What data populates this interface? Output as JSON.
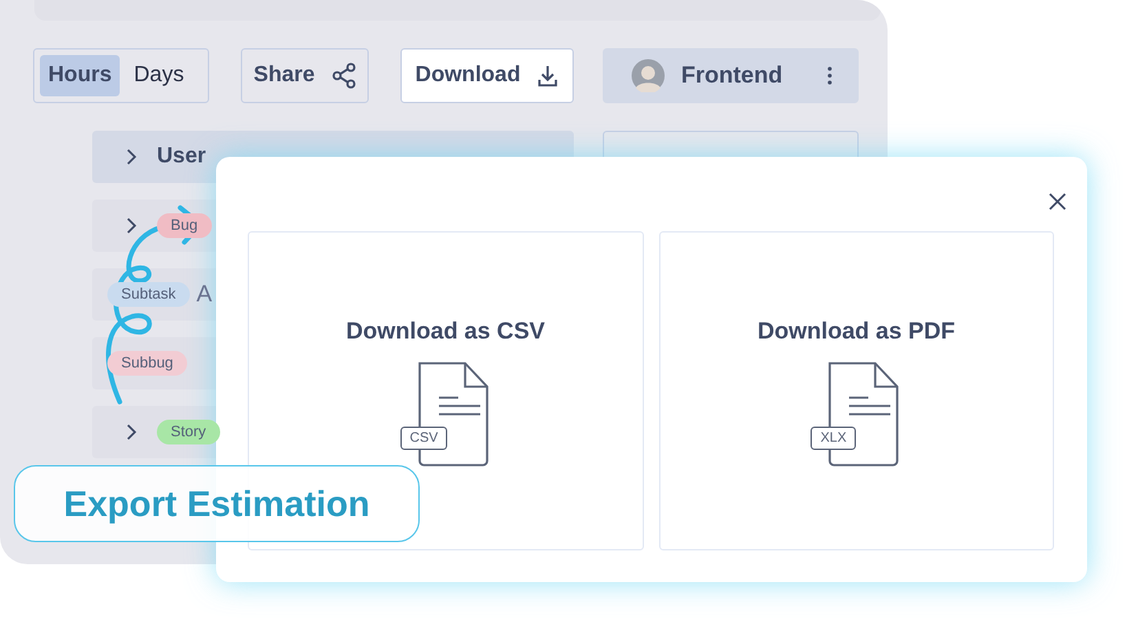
{
  "toolbar": {
    "unit_toggle": [
      {
        "label": "Hours",
        "selected": true
      },
      {
        "label": "Days",
        "selected": false
      }
    ],
    "share": "Share",
    "download": "Download",
    "team": "Frontend"
  },
  "rows": [
    {
      "kind": "group",
      "title": "User"
    },
    {
      "kind": "issue",
      "tag": "Bug",
      "color": "#f0bcc4"
    },
    {
      "kind": "subtask",
      "tag": "Subtask",
      "color": "#c9dbef",
      "title": "A"
    },
    {
      "kind": "subtask",
      "tag": "Subbug",
      "color": "#f2ccd3"
    },
    {
      "kind": "issue",
      "tag": "Story",
      "color": "#a8e6a6"
    }
  ],
  "modal": {
    "options": [
      {
        "title": "Download as CSV",
        "file_type": "CSV"
      },
      {
        "title": "Download as PDF",
        "file_type": "XLX"
      }
    ]
  },
  "badge": "Export Estimation"
}
